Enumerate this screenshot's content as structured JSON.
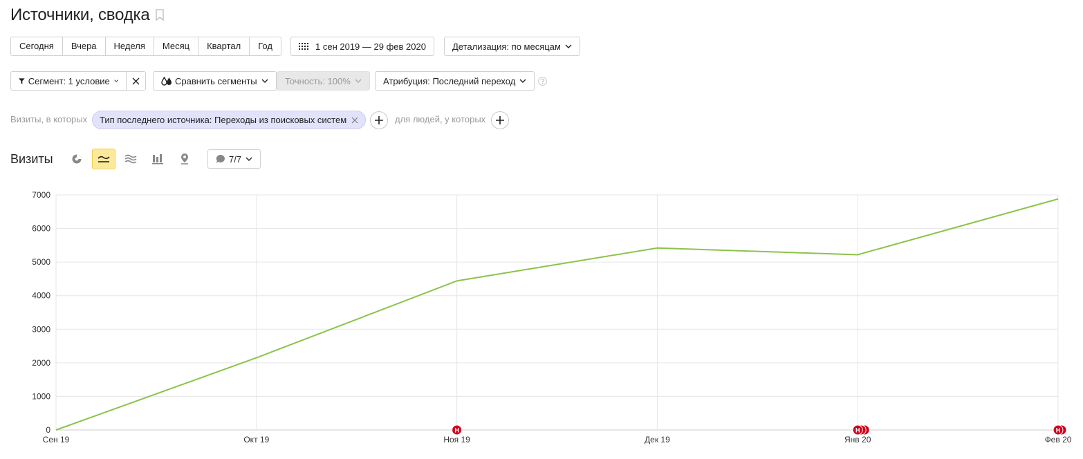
{
  "header": {
    "title": "Источники, сводка"
  },
  "periods": [
    "Сегодня",
    "Вчера",
    "Неделя",
    "Месяц",
    "Квартал",
    "Год"
  ],
  "date_range": "1 сен 2019 — 29 фев 2020",
  "detail": "Детализация: по месяцам",
  "filters": {
    "segment": "Сегмент: 1 условие",
    "compare": "Сравнить сегменты",
    "accuracy": "Точность: 100%",
    "attribution": "Атрибуция: Последний переход"
  },
  "condition": {
    "prefix": "Визиты, в которых",
    "chip": "Тип последнего источника: Переходы из поисковых систем",
    "people": "для людей, у которых"
  },
  "section": {
    "title": "Визиты",
    "notes": "7/7"
  },
  "chart_data": {
    "type": "line",
    "categories": [
      "Сен 19",
      "Окт 19",
      "Ноя 19",
      "Дек 19",
      "Янв 20",
      "Фев 20"
    ],
    "series": [
      {
        "values": [
          0,
          2150,
          4440,
          5420,
          5220,
          6880
        ],
        "color": "#8bc34a"
      }
    ],
    "ylim": [
      0,
      7000
    ],
    "yticks": [
      0,
      1000,
      2000,
      3000,
      4000,
      5000,
      6000,
      7000
    ],
    "grid": true,
    "markers": [
      {
        "category": "Ноя 19",
        "label": "Н",
        "count": 1
      },
      {
        "category": "Янв 20",
        "label": "Н",
        "count": 3
      },
      {
        "category": "Фев 20",
        "label": "Н",
        "count": 2
      }
    ]
  }
}
